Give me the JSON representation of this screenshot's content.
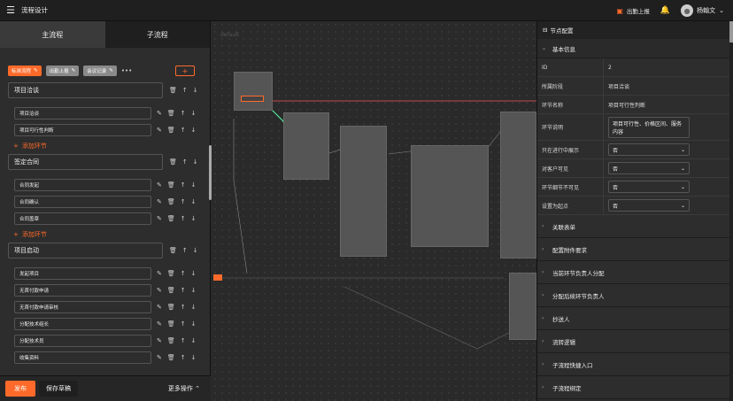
{
  "topbar": {
    "title": "流程设计",
    "report_label": "出勤上报",
    "user_name": "杨翰文"
  },
  "left": {
    "tabs": [
      "主流程",
      "子流程"
    ],
    "chips": [
      "标准流程",
      "出勤上报",
      "会议记录"
    ],
    "add_step_label": "添加环节",
    "stages": [
      {
        "name": "项目洽谈",
        "steps": [
          "项目洽谈",
          "项目可行性判断"
        ],
        "show_add": true
      },
      {
        "name": "签定合同",
        "steps": [
          "合同发起",
          "合同确认",
          "合同盖章"
        ],
        "show_add": true
      },
      {
        "name": "项目启动",
        "steps": [
          "发起项目",
          "无首付款申请",
          "无首付款申请审核",
          "分配技术组长",
          "分配技术员",
          "收集资料"
        ],
        "show_add": false
      }
    ],
    "publish_label": "发布",
    "save_label": "保存草稿",
    "more_label": "更多操作"
  },
  "canvas": {
    "label": "default"
  },
  "right": {
    "header": "节点配置",
    "basic_section": "基本信息",
    "fields": {
      "id_label": "ID",
      "id_value": "2",
      "stage_label": "所属阶段",
      "stage_value": "项目洽谈",
      "name_label": "环节名称",
      "name_value": "项目可行性判断",
      "desc_label": "环节说明",
      "desc_value": "项目可行性、价格区间、服务内容",
      "ongoing_label": "只在进行中展示",
      "ongoing_value": "否",
      "client_label": "对客户可见",
      "client_value": "否",
      "detail_label": "环节细节不可见",
      "detail_value": "否",
      "start_label": "设置为起点",
      "start_value": "否"
    },
    "sections": [
      "关联表单",
      "配置附件要求",
      "当前环节负责人分配",
      "分配后续环节负责人",
      "抄送人",
      "流转逻辑",
      "子流程快捷入口",
      "子流程绑定"
    ]
  }
}
